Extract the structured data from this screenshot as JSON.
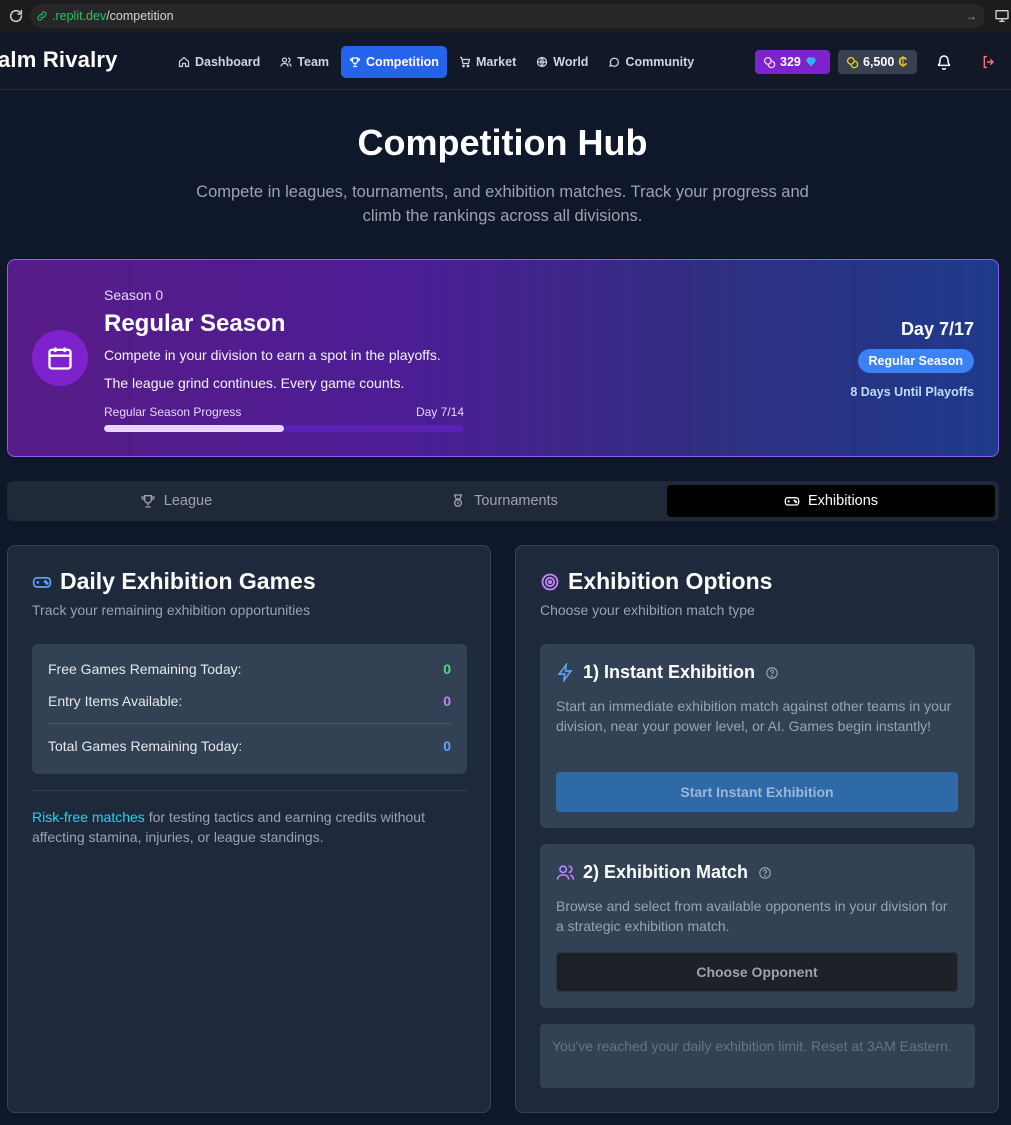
{
  "browser": {
    "url_host": ".replit.dev",
    "url_path": "/competition"
  },
  "header": {
    "brand": "alm Rivalry",
    "nav": [
      {
        "label": "Dashboard",
        "icon": "home-icon"
      },
      {
        "label": "Team",
        "icon": "users-icon"
      },
      {
        "label": "Competition",
        "icon": "trophy-icon",
        "active": true
      },
      {
        "label": "Market",
        "icon": "cart-icon"
      },
      {
        "label": "World",
        "icon": "globe-icon"
      },
      {
        "label": "Community",
        "icon": "chat-icon"
      }
    ],
    "gems": "329",
    "credits": "6,500",
    "colors": {
      "gems_bg": "#7e22ce",
      "nav_active": "#2563eb"
    }
  },
  "hero": {
    "title": "Competition Hub",
    "subtitle": "Compete in leagues, tournaments, and exhibition matches. Track your progress and climb the rankings across all divisions."
  },
  "season": {
    "label": "Season 0",
    "title": "Regular Season",
    "desc1": "Compete in your division to earn a spot in the playoffs.",
    "desc2": "The league grind continues. Every game counts.",
    "progress_label": "Regular Season Progress",
    "progress_day": "Day 7/14",
    "progress_fraction": 0.5,
    "day": "Day 7/17",
    "phase_badge": "Regular Season",
    "days_until": "8 Days Until Playoffs"
  },
  "tabs": [
    {
      "label": "League",
      "icon": "trophy-icon"
    },
    {
      "label": "Tournaments",
      "icon": "medal-icon"
    },
    {
      "label": "Exhibitions",
      "icon": "gamepad-icon",
      "active": true
    }
  ],
  "daily": {
    "title": "Daily Exhibition Games",
    "subtitle": "Track your remaining exhibition opportunities",
    "stats": [
      {
        "label": "Free Games Remaining Today:",
        "value": "0",
        "color": "#4ade80"
      },
      {
        "label": "Entry Items Available:",
        "value": "0",
        "color": "#c084fc"
      },
      {
        "label": "Total Games Remaining Today:",
        "value": "0",
        "color": "#60a5fa"
      }
    ],
    "risk_highlight": "Risk-free matches",
    "risk_rest": " for testing tactics and earning credits without affecting stamina, injuries, or league standings."
  },
  "options": {
    "title": "Exhibition Options",
    "subtitle": "Choose your exhibition match type",
    "instant": {
      "title": "1) Instant Exhibition",
      "desc": "Start an immediate exhibition match against other teams in your division, near your power level, or AI. Games begin instantly!",
      "button": "Start Instant Exhibition"
    },
    "match": {
      "title": "2) Exhibition Match",
      "desc": "Browse and select from available opponents in your division for a strategic exhibition match.",
      "button": "Choose Opponent"
    },
    "limit_notice": "You've reached your daily exhibition limit. Reset at 3AM Eastern."
  }
}
